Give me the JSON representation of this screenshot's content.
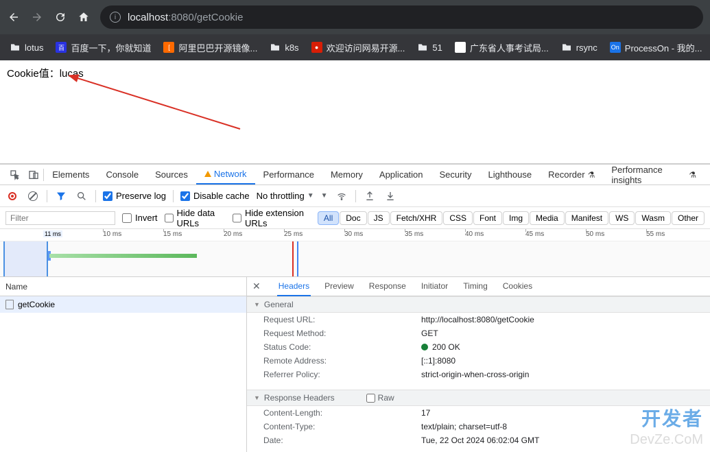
{
  "browser": {
    "url_host": "localhost",
    "url_port": ":8080",
    "url_path": "/getCookie"
  },
  "bookmarks": [
    {
      "label": "lotus",
      "type": "folder"
    },
    {
      "label": "百度一下，你就知道",
      "icon_bg": "#2932e1",
      "icon_txt": "百"
    },
    {
      "label": "阿里巴巴开源镜像...",
      "icon_bg": "#ff6a00",
      "icon_txt": "["
    },
    {
      "label": "k8s",
      "type": "folder"
    },
    {
      "label": "欢迎访问网易开源...",
      "icon_bg": "#d81e06",
      "icon_txt": "●"
    },
    {
      "label": "51",
      "type": "folder"
    },
    {
      "label": "广东省人事考试局...",
      "icon_bg": "#fff",
      "icon_txt": "◎"
    },
    {
      "label": "rsync",
      "type": "folder"
    },
    {
      "label": "ProcessOn - 我的...",
      "icon_bg": "#1a73e8",
      "icon_txt": "On"
    }
  ],
  "page_content": "Cookie值：lucas",
  "devtools": {
    "tabs": [
      "Elements",
      "Console",
      "Sources",
      "Network",
      "Performance",
      "Memory",
      "Application",
      "Security",
      "Lighthouse",
      "Recorder",
      "Performance insights"
    ],
    "active_tab": "Network",
    "controls": {
      "preserve_log": "Preserve log",
      "disable_cache": "Disable cache",
      "throttling": "No throttling"
    },
    "filter": {
      "placeholder": "Filter",
      "invert": "Invert",
      "hide_data": "Hide data URLs",
      "hide_ext": "Hide extension URLs",
      "pills": [
        "All",
        "Doc",
        "JS",
        "Fetch/XHR",
        "CSS",
        "Font",
        "Img",
        "Media",
        "Manifest",
        "WS",
        "Wasm",
        "Other"
      ]
    },
    "ruler_ticks": [
      "10 ms",
      "15 ms",
      "20 ms",
      "25 ms",
      "30 ms",
      "35 ms",
      "40 ms",
      "45 ms",
      "50 ms",
      "55 ms"
    ],
    "requests": {
      "header": "Name",
      "items": [
        "getCookie"
      ]
    },
    "detail_tabs": [
      "Headers",
      "Preview",
      "Response",
      "Initiator",
      "Timing",
      "Cookies"
    ],
    "sections": {
      "general_title": "General",
      "general": [
        {
          "k": "Request URL:",
          "v": "http://localhost:8080/getCookie"
        },
        {
          "k": "Request Method:",
          "v": "GET"
        },
        {
          "k": "Status Code:",
          "v": "200 OK",
          "status": true
        },
        {
          "k": "Remote Address:",
          "v": "[::1]:8080"
        },
        {
          "k": "Referrer Policy:",
          "v": "strict-origin-when-cross-origin"
        }
      ],
      "resp_title": "Response Headers",
      "raw_label": "Raw",
      "resp": [
        {
          "k": "Content-Length:",
          "v": "17"
        },
        {
          "k": "Content-Type:",
          "v": "text/plain; charset=utf-8"
        },
        {
          "k": "Date:",
          "v": "Tue, 22 Oct 2024 06:02:04 GMT"
        }
      ]
    }
  },
  "watermark1": "开发者",
  "watermark2": "DevZe.CoM"
}
